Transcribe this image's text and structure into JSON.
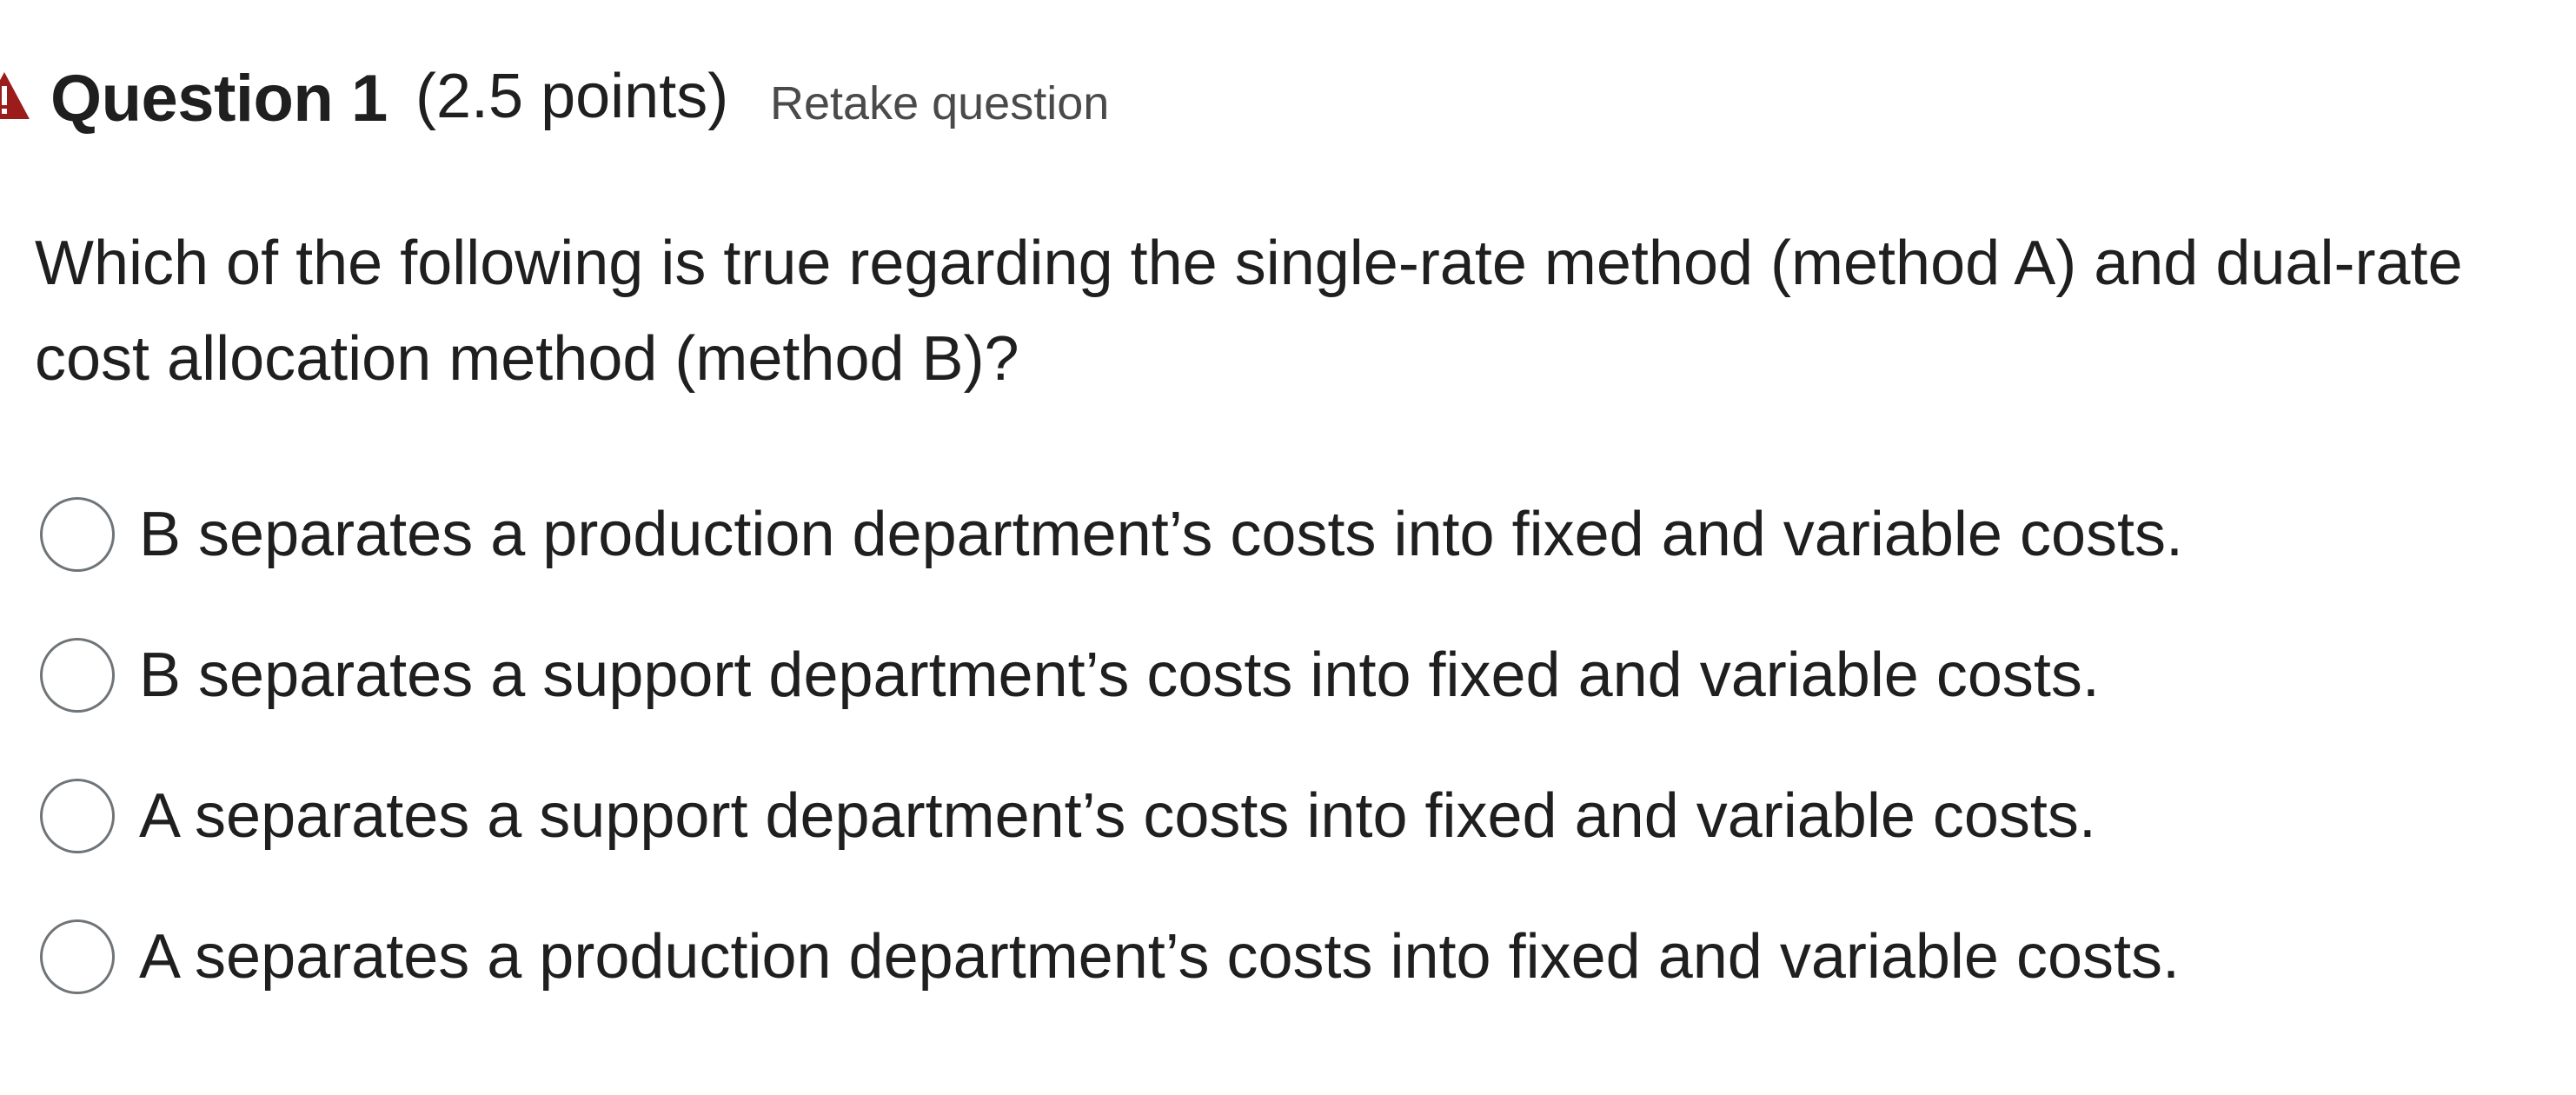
{
  "question": {
    "title": "Question 1",
    "points": "(2.5 points)",
    "retake_label": "Retake question",
    "text": "Which of the following is true regarding the single-rate method (method A) and dual-rate cost allocation method (method B)?",
    "warning_icon": "warning-triangle-icon",
    "warning_color": "#9c1c1c"
  },
  "options": [
    {
      "label": "B separates a production department’s costs into fixed and variable costs.",
      "selected": false
    },
    {
      "label": "B separates a support department’s costs into fixed and variable costs.",
      "selected": false
    },
    {
      "label": "A separates a support department’s costs into fixed and variable costs.",
      "selected": false
    },
    {
      "label": "A separates a production department’s costs into fixed and variable costs.",
      "selected": false
    }
  ]
}
